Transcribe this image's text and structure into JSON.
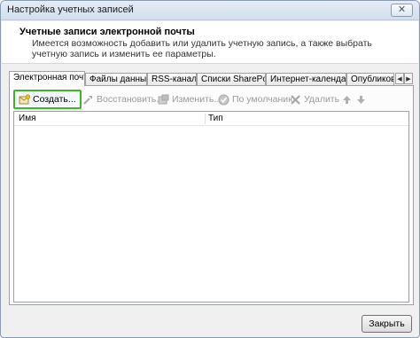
{
  "window": {
    "title": "Настройка учетных записей",
    "close_glyph": "✕"
  },
  "header": {
    "title": "Учетные записи электронной почты",
    "description": "Имеется возможность добавить или удалить учетную запись, а также выбрать учетную запись и изменить ее параметры."
  },
  "tabs": [
    {
      "label": "Электронная почта",
      "active": true
    },
    {
      "label": "Файлы данных"
    },
    {
      "label": "RSS-каналы"
    },
    {
      "label": "Списки SharePoint"
    },
    {
      "label": "Интернет-календари"
    },
    {
      "label": "Опубликова"
    }
  ],
  "tab_scroll": {
    "left": "◀",
    "right": "▶"
  },
  "toolbar": {
    "create": "Создать...",
    "restore": "Восстановить...",
    "change": "Изменить...",
    "default": "По умолчанию",
    "delete": "Удалить"
  },
  "grid": {
    "columns": [
      "Имя",
      "Тип"
    ]
  },
  "footer": {
    "close": "Закрыть"
  },
  "colors": {
    "create_highlight": "#3fb52c",
    "disabled_text": "#9a9a9a"
  }
}
